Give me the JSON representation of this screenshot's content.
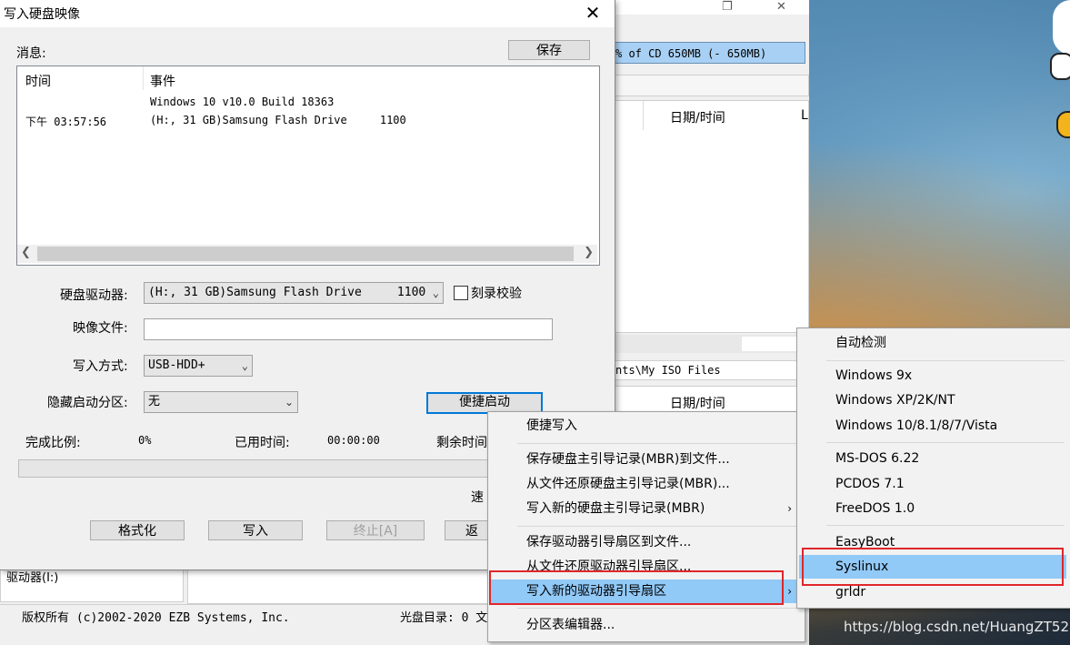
{
  "background_window": {
    "cd_capacity": "% of CD 650MB (- 650MB)",
    "column_date": "日期/时间",
    "column_l": "L",
    "path": "nts\\My ISO Files",
    "drive_label": "驱动器(I:)",
    "status_copyright": "版权所有 (c)2002-2020 EZB Systems, Inc.",
    "status_cd_dir": "光盘目录: 0 文"
  },
  "dialog": {
    "title": "写入硬盘映像",
    "close_icon": "close-icon",
    "messages_label": "消息:",
    "save_button": "保存",
    "log": {
      "columns": [
        "时间",
        "事件"
      ],
      "row1_event": "Windows 10 v10.0 Build 18363",
      "row2_time": "下午 03:57:56",
      "row2_event": "(H:, 31 GB)Samsung Flash Drive     1100"
    },
    "disk_drive_label": "硬盘驱动器:",
    "disk_drive_value": "(H:, 31 GB)Samsung Flash Drive     1100",
    "verify_label": "刻录校验",
    "image_file_label": "映像文件:",
    "image_file_value": "",
    "write_method_label": "写入方式:",
    "write_method_value": "USB-HDD+",
    "hidden_partition_label": "隐藏启动分区:",
    "hidden_partition_value": "无",
    "quick_boot_button": "便捷启动",
    "progress_label": "完成比例:",
    "progress_value": "0%",
    "progress_fraction": 0,
    "elapsed_label": "已用时间:",
    "elapsed_value": "00:00:00",
    "remaining_label": "剩余时间",
    "speed_label": "速",
    "buttons": {
      "format": "格式化",
      "write": "写入",
      "stop": "终止[A]",
      "back": "返"
    }
  },
  "context_menu": {
    "items": [
      "便捷写入",
      "保存硬盘主引导记录(MBR)到文件...",
      "从文件还原硬盘主引导记录(MBR)...",
      "写入新的硬盘主引导记录(MBR)",
      "保存驱动器引导扇区到文件...",
      "从文件还原驱动器引导扇区...",
      "写入新的驱动器引导扇区",
      "分区表编辑器..."
    ],
    "submenu_arrow": "›"
  },
  "submenu": {
    "items": [
      "自动检测",
      "Windows 9x",
      "Windows XP/2K/NT",
      "Windows 10/8.1/8/7/Vista",
      "MS-DOS 6.22",
      "PCDOS 7.1",
      "FreeDOS 1.0",
      "EasyBoot",
      "Syslinux",
      "grldr"
    ],
    "selected": "Syslinux"
  },
  "watermark": "https://blog.csdn.net/HuangZT521",
  "colors": {
    "menu_highlight": "#91c9f7",
    "annotation_red": "#e0262b",
    "focus_blue": "#0078d7"
  }
}
